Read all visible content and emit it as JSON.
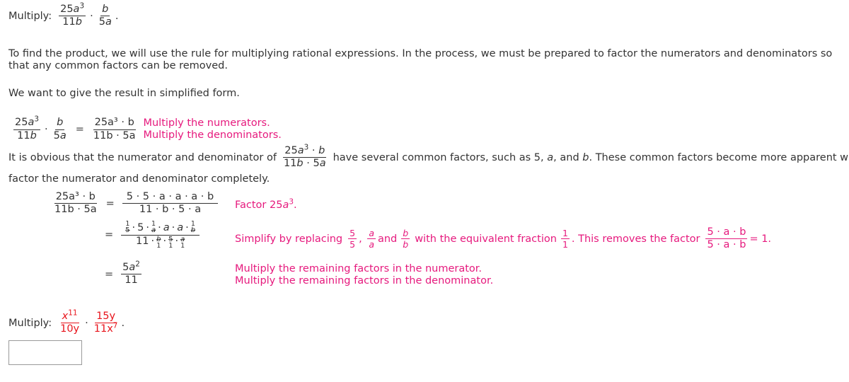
{
  "problem": {
    "label": "Multiply:",
    "frac1": {
      "num_coef": "25",
      "num_var": "a",
      "num_exp": "3",
      "den_coef": "11",
      "den_var": "b"
    },
    "frac2": {
      "num_var": "b",
      "den_coef": "5",
      "den_var": "a"
    },
    "dot": "·",
    "period": "."
  },
  "intro": {
    "paragraph1": "To find the product, we will use the rule for multiplying rational expressions. In the process, we must be prepared to factor the numerators and denominators so that any common factors can be removed.",
    "paragraph2": "We want to give the result in simplified form."
  },
  "step1": {
    "result_num": "25a³ · b",
    "result_den": "11b · 5a",
    "note_line1": "Multiply the numerators.",
    "note_line2": "Multiply the denominators."
  },
  "obvious": {
    "before": "It is obvious that the numerator and denominator of",
    "after_part1": "have several common factors, such as 5,",
    "var_a": "a",
    "and": ", and",
    "var_b": "b",
    "after_part2": ". These common factors become more apparent when w",
    "line2": "factor the numerator and denominator completely."
  },
  "step2": {
    "lhs_num": "25a³ · b",
    "lhs_den": "11b · 5a",
    "rhs_num": "5 · 5 · a · a · a · b",
    "rhs_den": "11 · b · 5 · a",
    "note": "Factor 25a³."
  },
  "step3": {
    "num_terms": [
      "5",
      "5",
      "a",
      "a",
      "a",
      "b"
    ],
    "den_terms": [
      "11",
      "b",
      "5",
      "a"
    ],
    "one": "1",
    "note_prefix": "Simplify by replacing",
    "f1": {
      "num": "5",
      "den": "5"
    },
    "f2": {
      "num": "a",
      "den": "a"
    },
    "and": "and",
    "f3": {
      "num": "b",
      "den": "b"
    },
    "note_mid": "with the equivalent fraction",
    "f4": {
      "num": "1",
      "den": "1"
    },
    "note_after": ". This removes the factor",
    "f5": {
      "num": "5 · a · b",
      "den": "5 · a · b"
    },
    "note_end": "= 1."
  },
  "step4": {
    "num": "5a²",
    "den": "11",
    "note_line1": "Multiply the remaining factors in the numerator.",
    "note_line2": "Multiply the remaining factors in the denominator."
  },
  "exercise": {
    "label": "Multiply:",
    "frac1": {
      "num_var": "x",
      "num_exp": "11",
      "den": "10y"
    },
    "frac2": {
      "num": "15y",
      "den_var": "11x",
      "den_exp": "7"
    },
    "answer_value": ""
  },
  "colors": {
    "explanation": "#e6197d",
    "exercise_numbers": "#e8141c",
    "text": "#333333"
  }
}
